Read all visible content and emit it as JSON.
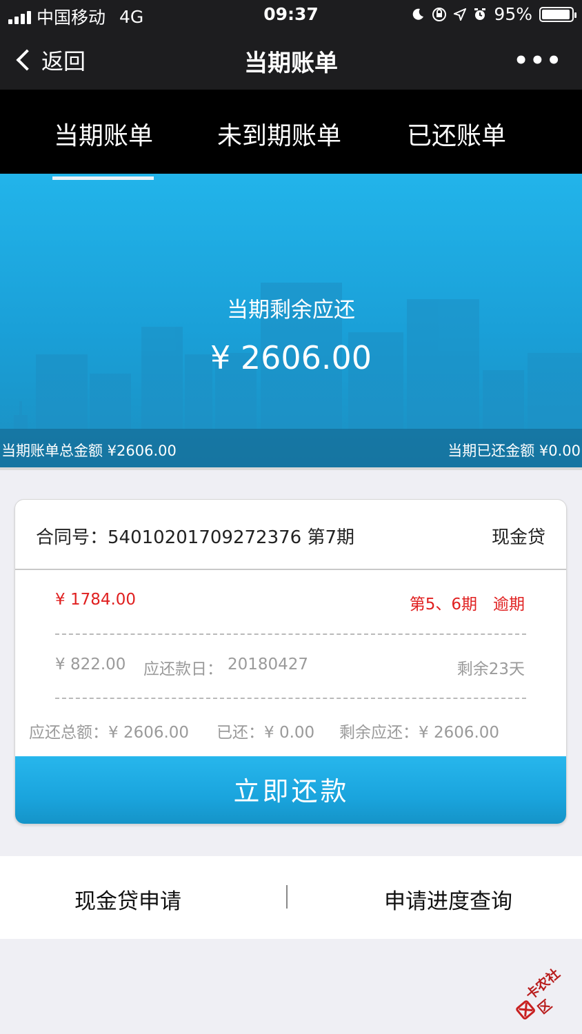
{
  "status_bar": {
    "carrier": "中国移动",
    "network": "4G",
    "time": "09:37",
    "battery": "95%",
    "battery_level": 0.95,
    "icons": [
      "signal-icon",
      "moon-icon",
      "rotation-lock-icon",
      "location-icon",
      "alarm-icon",
      "battery-icon"
    ]
  },
  "nav": {
    "back_label": "返回",
    "title": "当期账单",
    "more_label": "•••"
  },
  "tabs": [
    {
      "label": "当期账单",
      "active": true
    },
    {
      "label": "未到期账单",
      "active": false
    },
    {
      "label": "已还账单",
      "active": false
    }
  ],
  "summary": {
    "label": "当期剩余应还",
    "amount": "¥ 2606.00",
    "total_label": "当期账单总金额 ¥2606.00",
    "paid_label": "当期已还金额 ¥0.00"
  },
  "card": {
    "contract": "合同号：54010201709272376 第7期",
    "loan_type": "现金贷",
    "overdue": {
      "amount": "¥ 1784.00",
      "periods": "第5、6期　逾期"
    },
    "upcoming": {
      "amount": "¥ 822.00",
      "due_date_label": "应还款日：",
      "due_date": "20180427",
      "remaining_days": "剩余23天"
    },
    "totals": {
      "total_due": "应还总额：¥ 2606.00",
      "paid": "已还：¥ 0.00",
      "remaining": "剩余应还：¥ 2606.00"
    },
    "pay_button": "立即还款"
  },
  "links": {
    "left": "现金贷申请",
    "right": "申请进度查询"
  },
  "watermark": "卡农社区",
  "colors": {
    "header_bg": "#1d1d1f",
    "accent_blue": "#1fa8e0",
    "overdue_red": "#e02020",
    "muted_gray": "#9a9a9a"
  }
}
